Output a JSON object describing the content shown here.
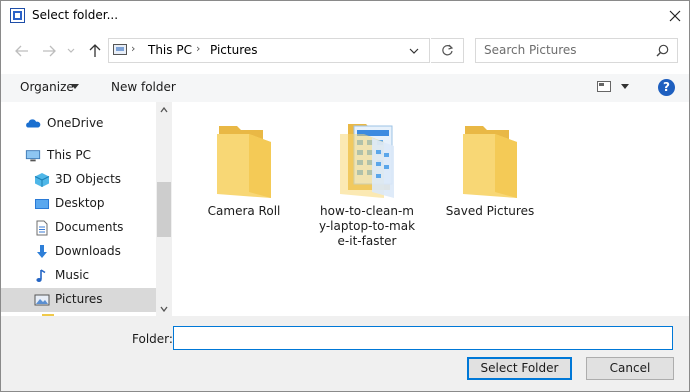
{
  "window": {
    "title": "Select folder..."
  },
  "address": {
    "segments": [
      "This PC",
      "Pictures"
    ]
  },
  "search": {
    "placeholder": "Search Pictures"
  },
  "toolbar": {
    "organize_label": "Organize",
    "new_folder_label": "New folder",
    "help_label": "?"
  },
  "sidebar": {
    "items": [
      {
        "label": "OneDrive",
        "icon": "onedrive-icon"
      },
      {
        "label": "This PC",
        "icon": "computer-icon"
      },
      {
        "label": "3D Objects",
        "icon": "cube-icon"
      },
      {
        "label": "Desktop",
        "icon": "desktop-icon"
      },
      {
        "label": "Documents",
        "icon": "document-icon"
      },
      {
        "label": "Downloads",
        "icon": "download-icon"
      },
      {
        "label": "Music",
        "icon": "music-icon"
      },
      {
        "label": "Pictures",
        "icon": "pictures-icon",
        "selected": true
      }
    ]
  },
  "folders": [
    {
      "name": "Camera Roll",
      "icon": "folder-icon"
    },
    {
      "name": "how-to-clean-my-laptop-to-make-it-faster",
      "icon": "folder-with-content-icon"
    },
    {
      "name": "Saved Pictures",
      "icon": "folder-icon"
    }
  ],
  "footer": {
    "folder_label": "Folder:",
    "folder_value": "",
    "select_button": "Select Folder",
    "cancel_button": "Cancel"
  },
  "colors": {
    "accent": "#0078d7",
    "folder": "#f8d775",
    "selection": "#d9d9d9"
  }
}
